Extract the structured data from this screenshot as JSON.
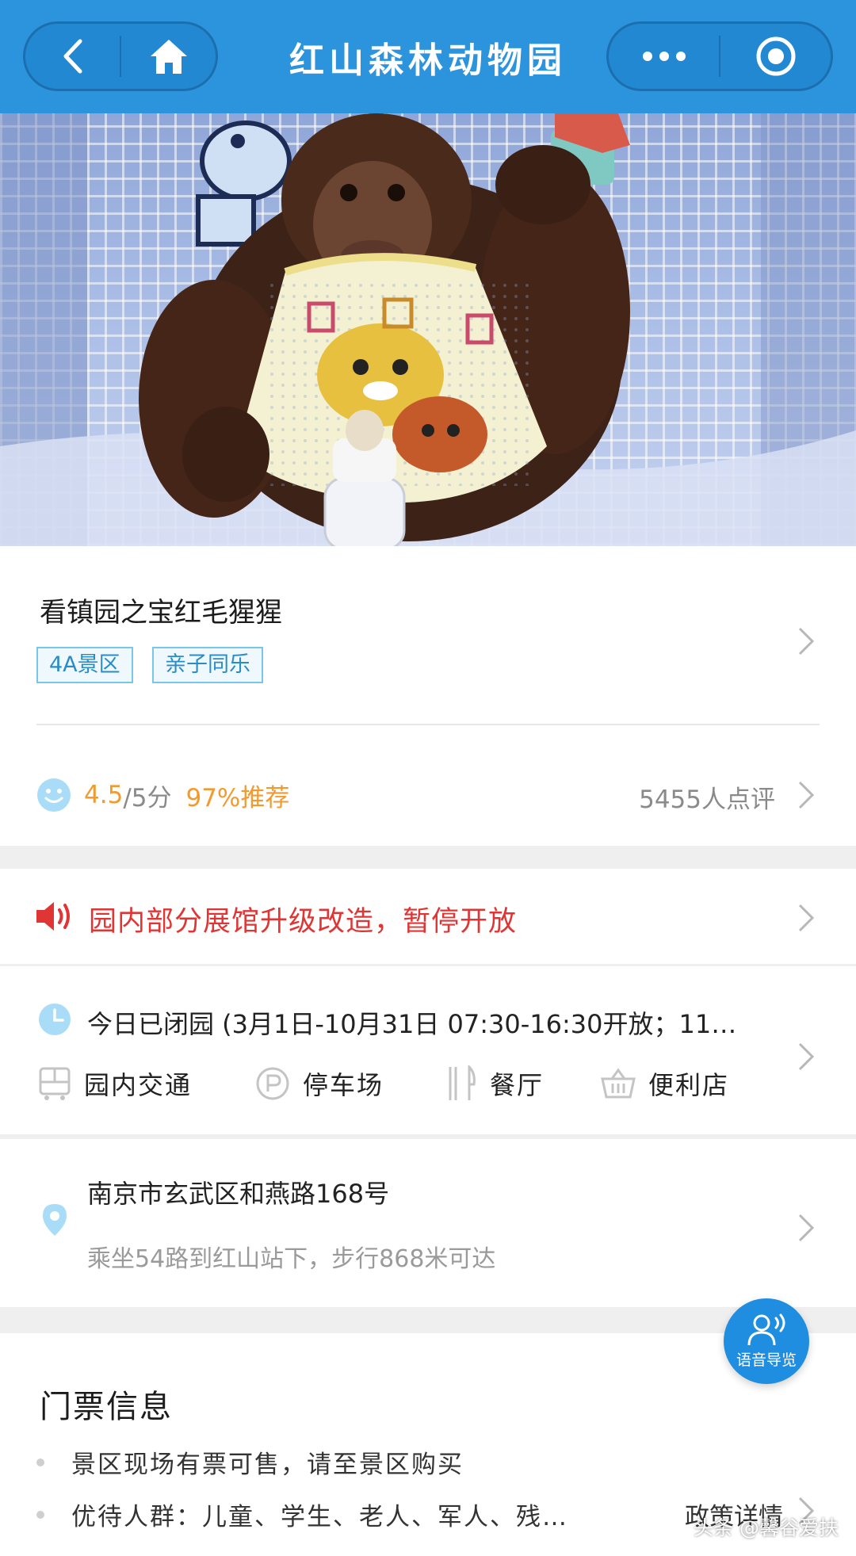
{
  "header": {
    "title": "红山森林动物园",
    "back_icon": "chevron-left-icon",
    "home_icon": "home-icon",
    "more_icon": "more-dots-icon",
    "target_icon": "target-icon"
  },
  "hero": {
    "icon": "photo-orangutan"
  },
  "overview": {
    "title": "看镇园之宝红毛猩猩",
    "tags": [
      "4A景区",
      "亲子同乐"
    ],
    "rating": {
      "score": "4.5",
      "max": "/5分",
      "recommend": "97%推荐",
      "reviews": "5455人点评",
      "score_value": 4.5,
      "recommend_value": 97
    }
  },
  "notice": {
    "text": "园内部分展馆升级改造，暂停开放",
    "icon": "speaker-icon"
  },
  "hours": {
    "text": "今日已闭园 (3月1日-10月31日 07:30-16:30开放；11…",
    "facilities": [
      {
        "label": "园内交通",
        "icon": "bus-icon"
      },
      {
        "label": "停车场",
        "icon": "parking-icon"
      },
      {
        "label": "餐厅",
        "icon": "restaurant-icon"
      },
      {
        "label": "便利店",
        "icon": "basket-icon"
      }
    ]
  },
  "address": {
    "line1": "南京市玄武区和燕路168号",
    "line2": "乘坐54路到红山站下，步行868米可达",
    "icon": "location-pin-icon"
  },
  "tickets": {
    "title": "门票信息",
    "items": [
      "景区现场有票可售，请至景区购买",
      "优待人群：儿童、学生、老人、军人、残…"
    ],
    "policy_link": "政策详情"
  },
  "voice_guide": {
    "label": "语音导览",
    "icon": "voice-guide-icon"
  },
  "watermark": "头条 @馨谷爱扶",
  "colors": {
    "header": "#2b94dd",
    "accent_orange": "#f29a2e",
    "notice_red": "#e03535",
    "tag_blue": "#2a8cc6",
    "icon_light_blue": "#a8dcf7"
  }
}
